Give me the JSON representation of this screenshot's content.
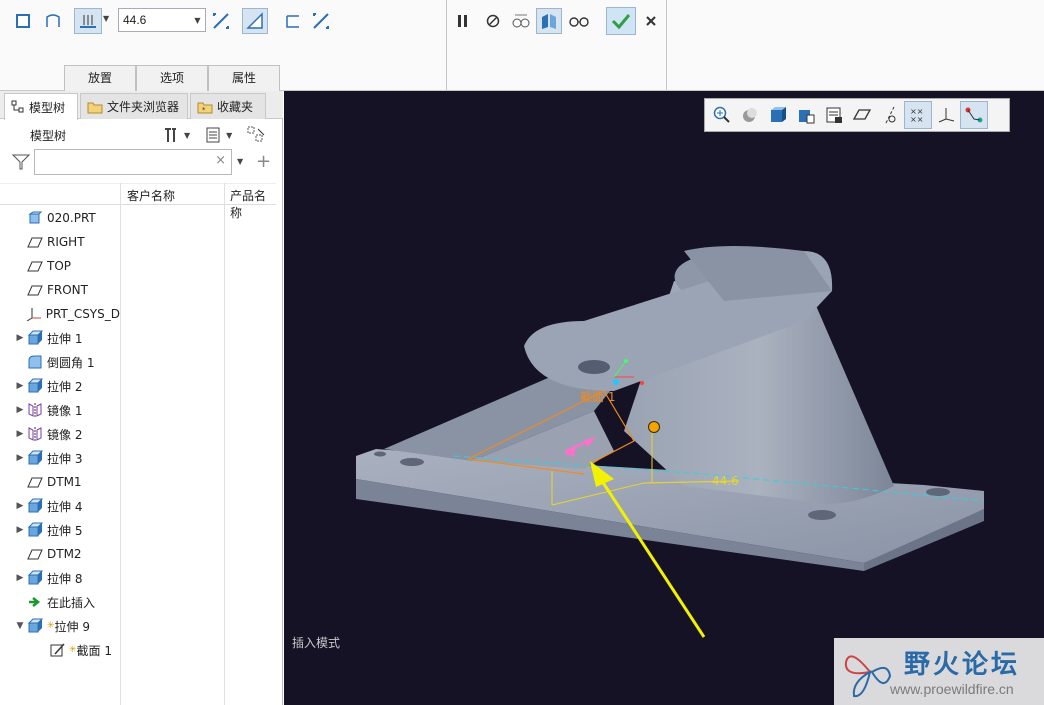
{
  "toolbar": {
    "depth_value": "44.6",
    "tabs": [
      "放置",
      "选项",
      "属性"
    ]
  },
  "panel": {
    "tabs": [
      "模型树",
      "文件夹浏览器",
      "收藏夹"
    ],
    "title": "模型树",
    "filter_placeholder": "",
    "columns": [
      "客户名称",
      "产品名称"
    ],
    "tree": [
      {
        "label": "020.PRT",
        "icon": "part-icon",
        "expand": false
      },
      {
        "label": "RIGHT",
        "icon": "datum-plane-icon",
        "expand": false
      },
      {
        "label": "TOP",
        "icon": "datum-plane-icon",
        "expand": false
      },
      {
        "label": "FRONT",
        "icon": "datum-plane-icon",
        "expand": false
      },
      {
        "label": "PRT_CSYS_D",
        "icon": "csys-icon",
        "expand": false
      },
      {
        "label": "拉伸 1",
        "icon": "extrude-icon",
        "expand": true
      },
      {
        "label": "倒圆角 1",
        "icon": "round-icon",
        "expand": false
      },
      {
        "label": "拉伸 2",
        "icon": "extrude-icon",
        "expand": true
      },
      {
        "label": "镜像 1",
        "icon": "mirror-icon",
        "expand": true
      },
      {
        "label": "镜像 2",
        "icon": "mirror-icon",
        "expand": true
      },
      {
        "label": "拉伸 3",
        "icon": "extrude-icon",
        "expand": true
      },
      {
        "label": "DTM1",
        "icon": "datum-plane-icon",
        "expand": false
      },
      {
        "label": "拉伸 4",
        "icon": "extrude-icon",
        "expand": true
      },
      {
        "label": "拉伸 5",
        "icon": "extrude-icon",
        "expand": true
      },
      {
        "label": "DTM2",
        "icon": "datum-plane-icon",
        "expand": false
      },
      {
        "label": "拉伸 8",
        "icon": "extrude-icon",
        "expand": true
      },
      {
        "label": "在此插入",
        "icon": "insert-arrow-icon",
        "expand": false
      },
      {
        "label": "拉伸 9",
        "icon": "extrude-icon",
        "expand": "open",
        "new": true
      },
      {
        "label": "截面 1",
        "icon": "sketch-icon",
        "expand": false,
        "new": true,
        "indent": true
      }
    ]
  },
  "viewport": {
    "section_label": "截面 1",
    "dimension_label": "44.6",
    "mode_text": "插入模式",
    "background_color": "#161226"
  },
  "watermark": {
    "title": "野火论坛",
    "url": "www.proewildfire.cn"
  }
}
